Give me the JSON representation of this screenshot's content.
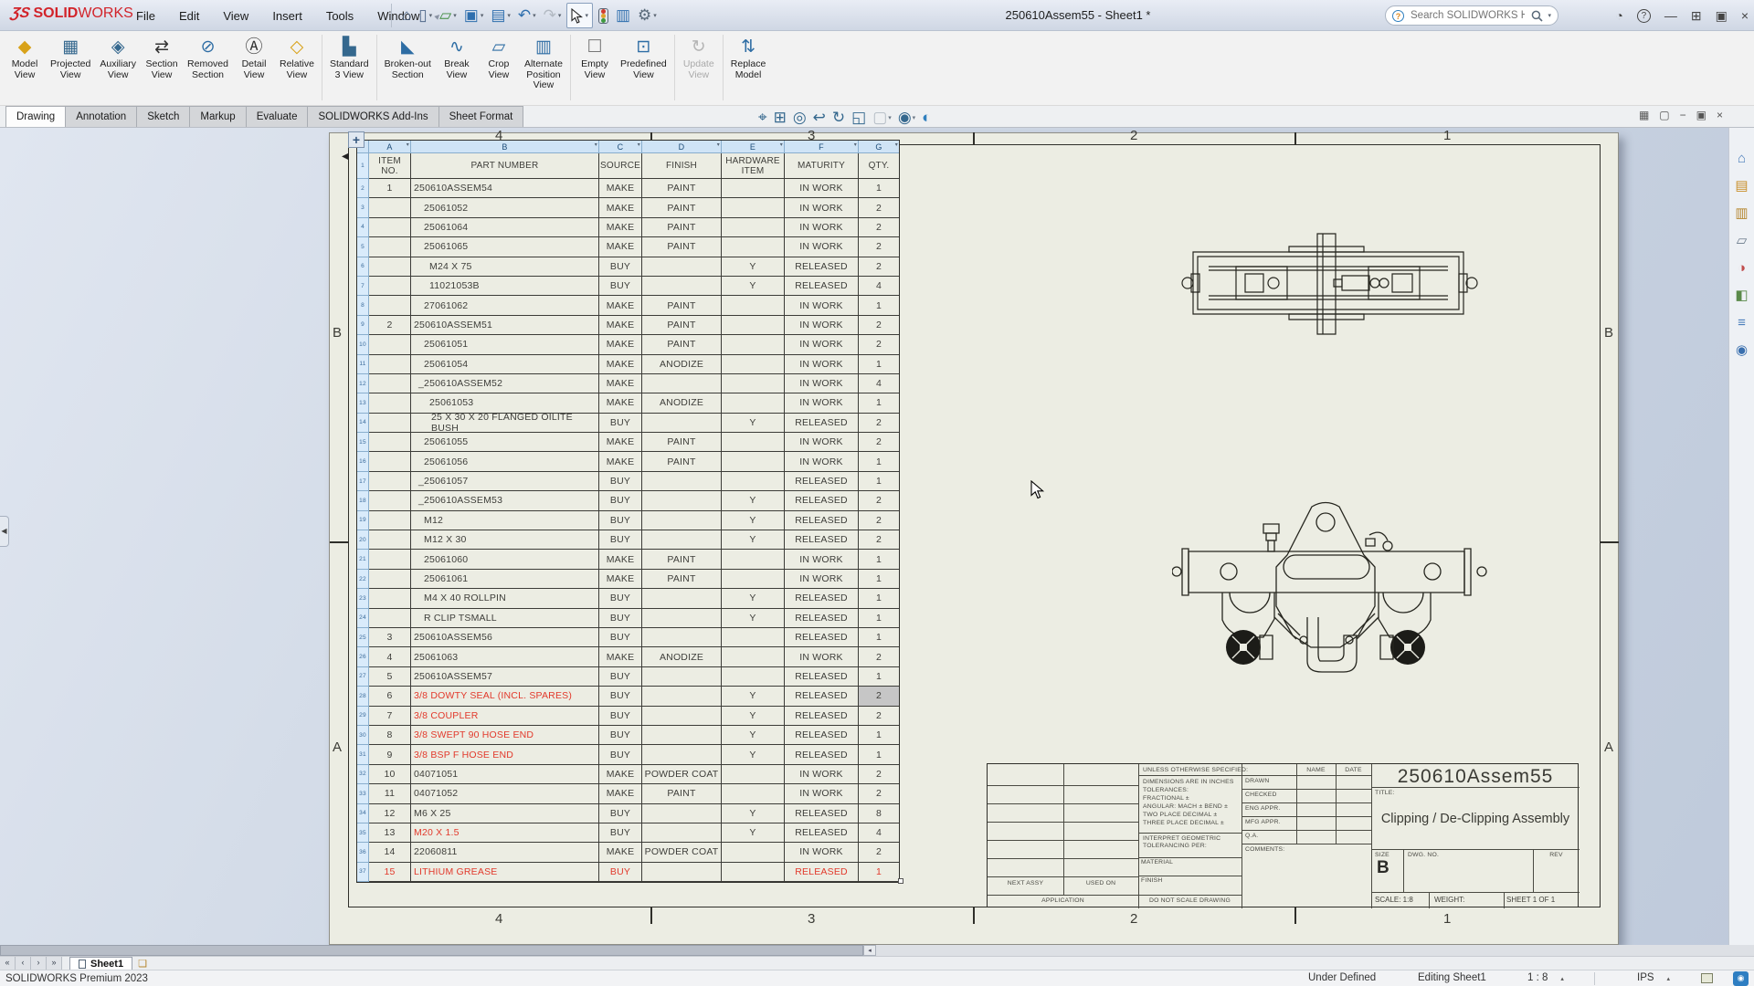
{
  "window": {
    "logo_mark": "ƷS",
    "logo_text_bold": "SOLID",
    "logo_text_light": "WORKS",
    "title": "250610Assem55 - Sheet1 *",
    "menus": [
      "File",
      "Edit",
      "View",
      "Insert",
      "Tools",
      "Window"
    ],
    "search_placeholder": "Search SOLIDWORKS Help",
    "quickbar": [
      {
        "name": "home-icon",
        "glyph": "⌂",
        "color": "#50688a",
        "dd": false
      },
      {
        "name": "new-document-icon",
        "glyph": "▯",
        "color": "#50688a",
        "dd": true
      },
      {
        "name": "open-icon",
        "glyph": "▱",
        "color": "#3d8b3d",
        "dd": true
      },
      {
        "name": "save-icon",
        "glyph": "▣",
        "color": "#2f6fae",
        "dd": true
      },
      {
        "name": "print-icon",
        "glyph": "▤",
        "color": "#2f6fae",
        "dd": true
      },
      {
        "name": "undo-icon",
        "glyph": "↶",
        "color": "#2f6fae",
        "dd": true
      },
      {
        "name": "redo-icon",
        "glyph": "↷",
        "color": "#b2b9c2",
        "dd": true,
        "disabled": true
      },
      {
        "name": "select-icon",
        "special": "select"
      },
      {
        "name": "rebuild-icon",
        "special": "traffic"
      },
      {
        "name": "file-properties-icon",
        "glyph": "▥",
        "color": "#2f6fae",
        "dd": false
      },
      {
        "name": "options-icon",
        "glyph": "⚙",
        "color": "#5a6a7a",
        "dd": true
      }
    ],
    "controls": [
      {
        "name": "user-account-icon",
        "glyph": "◔"
      },
      {
        "name": "help-icon",
        "glyph": "?"
      },
      {
        "name": "minimize-icon",
        "glyph": "—"
      },
      {
        "name": "span-displays-icon",
        "glyph": "⊞"
      },
      {
        "name": "restore-icon",
        "glyph": "▣"
      },
      {
        "name": "close-icon",
        "glyph": "×"
      }
    ]
  },
  "ribbon": {
    "buttons": [
      {
        "name": "model-view-button",
        "label": "Model\nView",
        "icon": "model-view-icon",
        "glyph": "◆",
        "color": "#d8a21a"
      },
      {
        "name": "projected-view-button",
        "label": "Projected\nView",
        "icon": "projected-view-icon",
        "glyph": "▦",
        "color": "#35688e"
      },
      {
        "name": "auxiliary-view-button",
        "label": "Auxiliary\nView",
        "icon": "auxiliary-view-icon",
        "glyph": "◈",
        "color": "#35688e"
      },
      {
        "name": "section-view-button",
        "label": "Section\nView",
        "icon": "section-view-icon",
        "glyph": "⇄",
        "color": "#333"
      },
      {
        "name": "removed-section-button",
        "label": "Removed\nSection",
        "icon": "removed-section-icon",
        "glyph": "⊘",
        "color": "#2e6da4"
      },
      {
        "name": "detail-view-button",
        "label": "Detail\nView",
        "icon": "detail-view-icon",
        "glyph": "Ⓐ",
        "color": "#333"
      },
      {
        "name": "relative-view-button",
        "label": "Relative\nView",
        "icon": "relative-view-icon",
        "glyph": "◇",
        "color": "#d8a21a"
      },
      {
        "name": "standard-3-view-button",
        "label": "Standard\n3 View",
        "icon": "standard-3-view-icon",
        "glyph": "▙",
        "color": "#35688e",
        "sep": true
      },
      {
        "name": "broken-out-section-button",
        "label": "Broken-out\nSection",
        "icon": "broken-out-section-icon",
        "glyph": "◣",
        "color": "#2e6da4",
        "sep": true
      },
      {
        "name": "break-view-button",
        "label": "Break\nView",
        "icon": "break-view-icon",
        "glyph": "∿",
        "color": "#2e6da4"
      },
      {
        "name": "crop-view-button",
        "label": "Crop\nView",
        "icon": "crop-view-icon",
        "glyph": "▱",
        "color": "#2e6da4"
      },
      {
        "name": "alternate-position-view-button",
        "label": "Alternate\nPosition\nView",
        "icon": "alternate-position-view-icon",
        "glyph": "▥",
        "color": "#2e6da4"
      },
      {
        "name": "empty-view-button",
        "label": "Empty\nView",
        "icon": "empty-view-icon",
        "glyph": "☐",
        "color": "#777",
        "sep": true
      },
      {
        "name": "predefined-view-button",
        "label": "Predefined\nView",
        "icon": "predefined-view-icon",
        "glyph": "⊡",
        "color": "#2e6da4"
      },
      {
        "name": "update-view-button",
        "label": "Update\nView",
        "icon": "update-view-icon",
        "glyph": "↻",
        "color": "#b5b5b5",
        "sep": true,
        "disabled": true
      },
      {
        "name": "replace-model-button",
        "label": "Replace\nModel",
        "icon": "replace-model-icon",
        "glyph": "⇅",
        "color": "#2e6da4",
        "sep": true
      }
    ],
    "tabs": [
      {
        "label": "Drawing",
        "active": true
      },
      {
        "label": "Annotation",
        "active": false
      },
      {
        "label": "Sketch",
        "active": false
      },
      {
        "label": "Markup",
        "active": false
      },
      {
        "label": "Evaluate",
        "active": false
      },
      {
        "label": "SOLIDWORKS Add-Ins",
        "active": false
      },
      {
        "label": "Sheet Format",
        "active": false
      }
    ]
  },
  "headsup": [
    {
      "name": "zoom-to-fit-icon",
      "glyph": "⌖"
    },
    {
      "name": "zoom-to-area-icon",
      "glyph": "⊞"
    },
    {
      "name": "zoom-previous-icon",
      "glyph": "◎"
    },
    {
      "name": "previous-view-icon",
      "glyph": "↩"
    },
    {
      "name": "redraw-icon",
      "glyph": "↻"
    },
    {
      "name": "3d-drawing-view-icon",
      "glyph": "◱"
    },
    {
      "name": "display-style-icon",
      "glyph": "▢",
      "dd": true,
      "disabled": true
    },
    {
      "name": "hide-show-items-icon",
      "glyph": "◉",
      "dd": true
    },
    {
      "name": "view-settings-icon",
      "glyph": "◐",
      "sphere": true
    }
  ],
  "doc_controls": [
    {
      "name": "viewport-grid-icon",
      "glyph": "▦"
    },
    {
      "name": "viewport-single-icon",
      "glyph": "▢"
    },
    {
      "name": "doc-minimize-icon",
      "glyph": "−"
    },
    {
      "name": "doc-restore-icon",
      "glyph": "▣"
    },
    {
      "name": "doc-close-icon",
      "glyph": "×"
    }
  ],
  "task_pane": [
    {
      "name": "resources-home-icon",
      "glyph": "⌂",
      "color": "#4a7ebb"
    },
    {
      "name": "design-library-icon",
      "glyph": "▤",
      "color": "#c98f2a"
    },
    {
      "name": "file-explorer-icon",
      "glyph": "▥",
      "color": "#b5862e"
    },
    {
      "name": "view-palette-icon",
      "glyph": "▱",
      "color": "#6a7a8a"
    },
    {
      "name": "appearances-icon",
      "glyph": "◑",
      "color": "#c04d4d"
    },
    {
      "name": "scenes-icon",
      "glyph": "◧",
      "color": "#5a8a4a"
    },
    {
      "name": "custom-properties-icon",
      "glyph": "≡",
      "color": "#4a7ebb"
    },
    {
      "name": "forum-icon",
      "glyph": "◉",
      "color": "#3a6fae"
    }
  ],
  "sheet_zones": {
    "columns": [
      "4",
      "3",
      "2",
      "1"
    ],
    "rows": [
      "B",
      "A"
    ]
  },
  "bom": {
    "columns": [
      "A",
      "B",
      "C",
      "D",
      "E",
      "F",
      "G"
    ],
    "headers": [
      "ITEM NO.",
      "PART NUMBER",
      "SOURCE",
      "FINISH",
      "HARDWARE ITEM",
      "MATURITY",
      "QTY."
    ],
    "rows": [
      [
        "1",
        "250610ASSEM54",
        3,
        "MAKE",
        "PAINT",
        "",
        "IN WORK",
        "1",
        ""
      ],
      [
        "",
        "25061052",
        14,
        "MAKE",
        "PAINT",
        "",
        "IN WORK",
        "2",
        ""
      ],
      [
        "",
        "25061064",
        14,
        "MAKE",
        "PAINT",
        "",
        "IN WORK",
        "2",
        ""
      ],
      [
        "",
        "25061065",
        14,
        "MAKE",
        "PAINT",
        "",
        "IN WORK",
        "2",
        ""
      ],
      [
        "",
        "M24 X 75",
        20,
        "BUY",
        "",
        "Y",
        "RELEASED",
        "2",
        ""
      ],
      [
        "",
        "11021053B",
        20,
        "BUY",
        "",
        "Y",
        "RELEASED",
        "4",
        ""
      ],
      [
        "",
        "27061062",
        14,
        "MAKE",
        "PAINT",
        "",
        "IN WORK",
        "1",
        ""
      ],
      [
        "2",
        "250610ASSEM51",
        3,
        "MAKE",
        "PAINT",
        "",
        "IN WORK",
        "2",
        ""
      ],
      [
        "",
        "25061051",
        14,
        "MAKE",
        "PAINT",
        "",
        "IN WORK",
        "2",
        ""
      ],
      [
        "",
        "25061054",
        14,
        "MAKE",
        "ANODIZE",
        "",
        "IN WORK",
        "1",
        ""
      ],
      [
        "",
        "_250610ASSEM52",
        8,
        "MAKE",
        "",
        "",
        "IN WORK",
        "4",
        ""
      ],
      [
        "",
        "25061053",
        20,
        "MAKE",
        "ANODIZE",
        "",
        "IN WORK",
        "1",
        ""
      ],
      [
        "",
        "25 X 30 X 20 FLANGED OILITE BUSH",
        22,
        "BUY",
        "",
        "Y",
        "RELEASED",
        "2",
        ""
      ],
      [
        "",
        "25061055",
        14,
        "MAKE",
        "PAINT",
        "",
        "IN WORK",
        "2",
        ""
      ],
      [
        "",
        "25061056",
        14,
        "MAKE",
        "PAINT",
        "",
        "IN WORK",
        "1",
        ""
      ],
      [
        "",
        "_25061057",
        8,
        "BUY",
        "",
        "",
        "RELEASED",
        "1",
        ""
      ],
      [
        "",
        "_250610ASSEM53",
        8,
        "BUY",
        "",
        "Y",
        "RELEASED",
        "2",
        ""
      ],
      [
        "",
        "M12",
        14,
        "BUY",
        "",
        "Y",
        "RELEASED",
        "2",
        ""
      ],
      [
        "",
        "M12 X 30",
        14,
        "BUY",
        "",
        "Y",
        "RELEASED",
        "2",
        ""
      ],
      [
        "",
        "25061060",
        14,
        "MAKE",
        "PAINT",
        "",
        "IN WORK",
        "1",
        ""
      ],
      [
        "",
        "25061061",
        14,
        "MAKE",
        "PAINT",
        "",
        "IN WORK",
        "1",
        ""
      ],
      [
        "",
        "M4 X 40 ROLLPIN",
        14,
        "BUY",
        "",
        "Y",
        "RELEASED",
        "1",
        ""
      ],
      [
        "",
        "R CLIP TSMALL",
        14,
        "BUY",
        "",
        "Y",
        "RELEASED",
        "1",
        ""
      ],
      [
        "3",
        "250610ASSEM56",
        3,
        "BUY",
        "",
        "",
        "RELEASED",
        "1",
        ""
      ],
      [
        "4",
        "25061063",
        3,
        "MAKE",
        "ANODIZE",
        "",
        "IN WORK",
        "2",
        ""
      ],
      [
        "5",
        "250610ASSEM57",
        3,
        "BUY",
        "",
        "",
        "RELEASED",
        "1",
        ""
      ],
      [
        "6",
        "3/8 DOWTY SEAL (INCL. SPARES)",
        3,
        "BUY",
        "",
        "Y",
        "RELEASED",
        "2",
        "red-part sel"
      ],
      [
        "7",
        "3/8 COUPLER",
        3,
        "BUY",
        "",
        "Y",
        "RELEASED",
        "2",
        "red-part"
      ],
      [
        "8",
        "3/8 SWEPT 90 HOSE END",
        3,
        "BUY",
        "",
        "Y",
        "RELEASED",
        "1",
        "red-part"
      ],
      [
        "9",
        "3/8 BSP F HOSE END",
        3,
        "BUY",
        "",
        "Y",
        "RELEASED",
        "1",
        "red-part"
      ],
      [
        "10",
        "04071051",
        3,
        "MAKE",
        "POWDER COAT",
        "",
        "IN WORK",
        "2",
        ""
      ],
      [
        "11",
        "04071052",
        3,
        "MAKE",
        "PAINT",
        "",
        "IN WORK",
        "2",
        ""
      ],
      [
        "12",
        "M6 X 25",
        3,
        "BUY",
        "",
        "Y",
        "RELEASED",
        "8",
        ""
      ],
      [
        "13",
        "M20 X 1.5",
        3,
        "BUY",
        "",
        "Y",
        "RELEASED",
        "4",
        "red-part"
      ],
      [
        "14",
        "22060811",
        3,
        "MAKE",
        "POWDER COAT",
        "",
        "IN WORK",
        "2",
        ""
      ],
      [
        "15",
        "LITHIUM GREASE",
        3,
        "BUY",
        "",
        "",
        "RELEASED",
        "1",
        "red-all"
      ]
    ]
  },
  "title_block": {
    "drawing_number": "250610Assem55",
    "title_label": "TITLE:",
    "title": "Clipping / De-Clipping Assembly",
    "size_label": "SIZE",
    "size": "B",
    "dwg_label": "DWG.  NO.",
    "rev_label": "REV",
    "scale": "SCALE: 1:8",
    "weight_label": "WEIGHT:",
    "sheet": "SHEET 1 OF 1",
    "unless": "UNLESS OTHERWISE SPECIFIED:",
    "tolerance_lines": [
      "DIMENSIONS ARE IN INCHES",
      "TOLERANCES:",
      "FRACTIONAL ±",
      "ANGULAR: MACH ±    BEND ±",
      "TWO PLACE DECIMAL    ±",
      "THREE PLACE DECIMAL  ±"
    ],
    "interpret_line1": "INTERPRET GEOMETRIC",
    "interpret_line2": "TOLERANCING PER:",
    "material_label": "MATERIAL",
    "finish_label": "FINISH",
    "next_assy": "NEXT ASSY",
    "used_on": "USED ON",
    "application": "APPLICATION",
    "do_not_scale": "DO NOT SCALE DRAWING",
    "name_label": "NAME",
    "date_label": "DATE",
    "approval_rows": [
      "DRAWN",
      "CHECKED",
      "ENG APPR.",
      "MFG APPR.",
      "Q.A.",
      "COMMENTS:"
    ]
  },
  "sheet_tabs": {
    "nav": [
      "«",
      "‹",
      "›",
      "»"
    ],
    "active": "Sheet1"
  },
  "status_bar": {
    "left": "SOLIDWORKS Premium 2023",
    "definition": "Under Defined",
    "editing": "Editing Sheet1",
    "scale": "1 : 8",
    "units": "IPS"
  }
}
